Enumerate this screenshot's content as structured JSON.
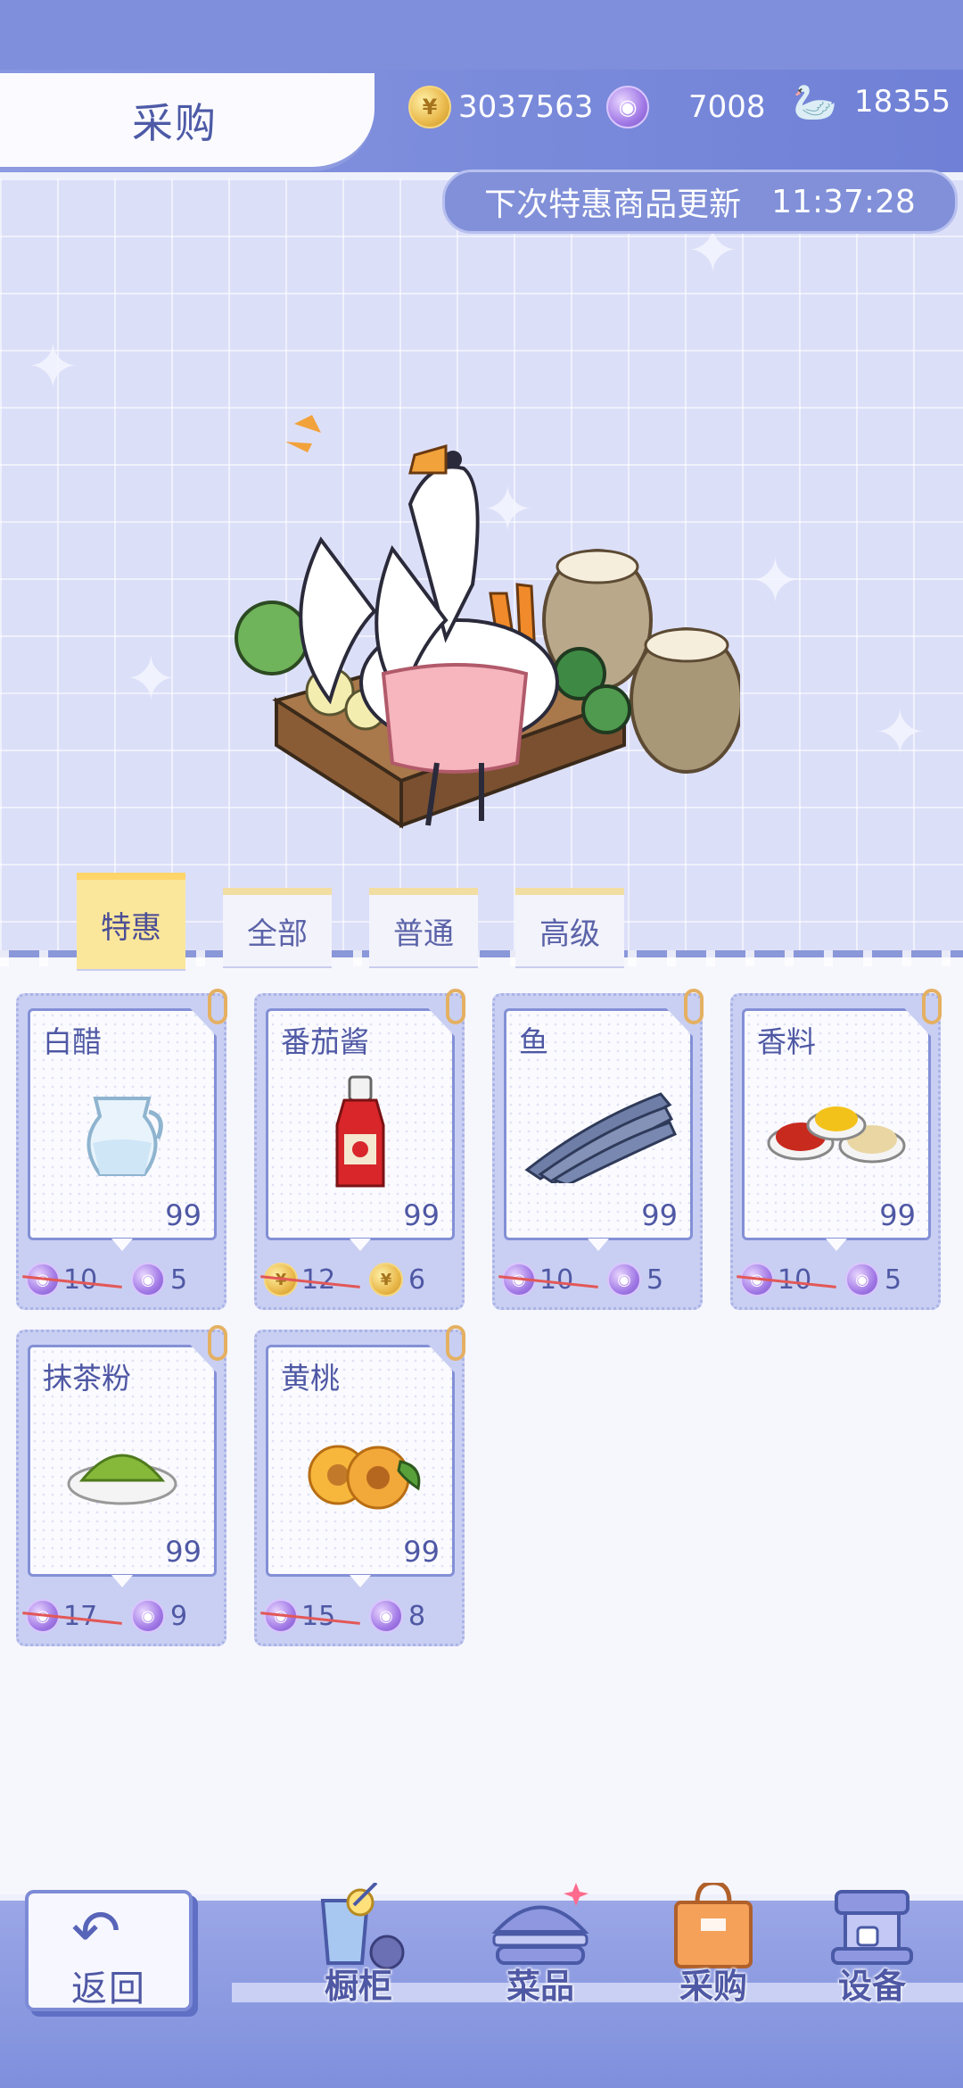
{
  "header": {
    "title": "采购",
    "currencies": [
      {
        "icon": "gold-coin-icon",
        "value": "3037563"
      },
      {
        "icon": "purple-gem-icon",
        "value": "7008"
      },
      {
        "icon": "swan-token-add-icon",
        "value": "18355"
      }
    ]
  },
  "timer": {
    "label": "下次特惠商品更新",
    "time": "11:37:28"
  },
  "banner": {
    "illustration": "goose-with-vegetables-crate-illustration"
  },
  "tabs": [
    {
      "label": "特惠",
      "active": true
    },
    {
      "label": "全部",
      "active": false
    },
    {
      "label": "普通",
      "active": false
    },
    {
      "label": "高级",
      "active": false
    }
  ],
  "items": [
    {
      "name": "白醋",
      "qty": "99",
      "currency": "purple-gem-icon",
      "old_price": "10",
      "new_price": "5",
      "art": "vinegar-pitcher-icon"
    },
    {
      "name": "番茄酱",
      "qty": "99",
      "currency": "gold-coin-icon",
      "old_price": "12",
      "new_price": "6",
      "art": "ketchup-bottle-icon"
    },
    {
      "name": "鱼",
      "qty": "99",
      "currency": "purple-gem-icon",
      "old_price": "10",
      "new_price": "5",
      "art": "fish-icon"
    },
    {
      "name": "香料",
      "qty": "99",
      "currency": "purple-gem-icon",
      "old_price": "10",
      "new_price": "5",
      "art": "spices-icon"
    },
    {
      "name": "抹茶粉",
      "qty": "99",
      "currency": "purple-gem-icon",
      "old_price": "17",
      "new_price": "9",
      "art": "matcha-powder-icon"
    },
    {
      "name": "黄桃",
      "qty": "99",
      "currency": "purple-gem-icon",
      "old_price": "15",
      "new_price": "8",
      "art": "yellow-peach-icon"
    }
  ],
  "nav": {
    "back_label": "返回",
    "items": [
      {
        "label": "橱柜",
        "icon": "cabinet-drink-icon"
      },
      {
        "label": "菜品",
        "icon": "burger-dish-icon"
      },
      {
        "label": "采购",
        "icon": "shopping-bag-icon"
      },
      {
        "label": "设备",
        "icon": "coffee-machine-icon"
      }
    ]
  }
}
